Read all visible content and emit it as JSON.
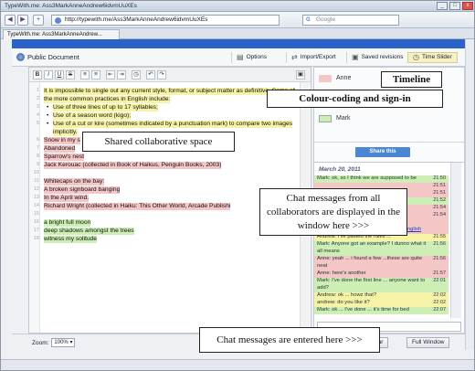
{
  "window": {
    "title": "TypeWith.me: Ass3MarkAnneAndrew6idvmUuXEs",
    "minimize": "_",
    "maximize": "□",
    "close": "x"
  },
  "browser": {
    "back": "◀",
    "forward": "▶",
    "new_tab": "+",
    "address": "http://typewith.me/Ass3MarkAnneAndrew6idvmUuXEs",
    "search_placeholder": "Google",
    "search_glyph": "G",
    "tab_title": "TypeWith.me: Ass3MarkAnneAndrew..."
  },
  "toolbar": {
    "doc_title": "Public Document",
    "options": "Options",
    "import_export": "Import/Export",
    "saved_revisions": "Saved revisions",
    "time_slider": "Time Slider"
  },
  "format_buttons": [
    "B",
    "I",
    "U",
    "S",
    "≡",
    "≡",
    "⇤",
    "⇥",
    "◷",
    "↶",
    "↷"
  ],
  "save_glyph": "▣",
  "editor_lines": [
    {
      "n": "1",
      "text": "It is impossible to single out any current style, format, or subject matter as definitive. Some of",
      "hl": "y",
      "bullet": false
    },
    {
      "n": "2",
      "text": "the more common practices in English include:",
      "hl": "y",
      "bullet": false
    },
    {
      "n": "3",
      "text": "Use of three lines of up to 17 syllables;",
      "hl": "y",
      "bullet": true
    },
    {
      "n": "4",
      "text": "Use of a season word (kigo);",
      "hl": "y",
      "bullet": true
    },
    {
      "n": "5",
      "text": "Use of a cut or kire (sometimes indicated by a punctuation mark) to compare two images",
      "hl": "y",
      "bullet": true
    },
    {
      "n": "",
      "text": "implicitly.",
      "hl": "y",
      "bullet": true,
      "cont": true
    },
    {
      "n": "6",
      "text": "Snow in my s",
      "hl": "p",
      "bullet": false
    },
    {
      "n": "7",
      "text": "Abandoned",
      "hl": "p",
      "bullet": false
    },
    {
      "n": "8",
      "text": "Sparrow's nest",
      "hl": "p",
      "bullet": false
    },
    {
      "n": "9",
      "text": "Jack Kerouac (collected in Book of Haikus, Penguin Books, 2003)",
      "hl": "p",
      "bullet": false
    },
    {
      "n": "10",
      "text": "",
      "hl": "",
      "bullet": false
    },
    {
      "n": "11",
      "text": "Whitecaps on the bay:",
      "hl": "p",
      "bullet": false
    },
    {
      "n": "12",
      "text": "A broken signboard banging",
      "hl": "p",
      "bullet": false
    },
    {
      "n": "13",
      "text": "In the April wind.",
      "hl": "p",
      "bullet": false
    },
    {
      "n": "14",
      "text": "Richard Wright (collected in Haiku: This Other World, Arcade Publishi",
      "hl": "p",
      "bullet": false
    },
    {
      "n": "15",
      "text": "",
      "hl": "",
      "bullet": false
    },
    {
      "n": "16",
      "text": "a bright full moon",
      "hl": "g",
      "bullet": false
    },
    {
      "n": "17",
      "text": "deep shadows amongst the trees",
      "hl": "g",
      "bullet": false
    },
    {
      "n": "18",
      "text": "witness my solitude",
      "hl": "g",
      "bullet": false
    }
  ],
  "authors": [
    {
      "name": "Anne",
      "color": "#f4c6c6"
    },
    {
      "name": "Mark",
      "color": "#cdeeb4"
    }
  ],
  "share_button": "Share this",
  "chat": {
    "date": "March 20, 2011",
    "messages": [
      {
        "text": "Mark: ok, so I think we are supposed to be",
        "time": "21:50",
        "color": "#cdeeb4"
      },
      {
        "text": "",
        "time": "21:51",
        "color": "#f4c6c6"
      },
      {
        "text": "",
        "time": "21:51",
        "color": "#f4c6c6"
      },
      {
        "text": "",
        "time": "21:52",
        "color": "#cdeeb4"
      },
      {
        "text": "",
        "time": "21:54",
        "color": "#f4c6c6"
      },
      {
        "text": "",
        "time": "21:54",
        "color": "#f4c6c6"
      },
      {
        "text": "Mark:",
        "time": "",
        "color": "#f4c6c6"
      },
      {
        "text": "http://en.wikipedia.org/wiki/Haiku_in_English",
        "time": "",
        "color": "#f4c6c6",
        "link": true
      },
      {
        "text": "Andrew: I've pasted the rules ...",
        "time": "21:55",
        "color": "#f6f3a6"
      },
      {
        "text": "Mark: Anyone got an example? I dunno what it",
        "time": "21:56",
        "color": "#cdeeb4"
      },
      {
        "text": "all means",
        "time": "",
        "color": "#cdeeb4"
      },
      {
        "text": "Anne: yeah ... i found a few ...these are quite",
        "time": "21:56",
        "color": "#f4c6c6"
      },
      {
        "text": "neat",
        "time": "",
        "color": "#f4c6c6"
      },
      {
        "text": "Anne: here's another",
        "time": "21:57",
        "color": "#f4c6c6"
      },
      {
        "text": "Mark: I've done the first line ... anyone want to",
        "time": "22:01",
        "color": "#cdeeb4"
      },
      {
        "text": "add?",
        "time": "",
        "color": "#cdeeb4"
      },
      {
        "text": "Andrew: ok ... howz that?",
        "time": "22:02",
        "color": "#f6f3a6"
      },
      {
        "text": "andrew: do you like it?",
        "time": "22:02",
        "color": "#f6f3a6"
      },
      {
        "text": "Mark: ok ... I've done ... it's time for bed",
        "time": "22:07",
        "color": "#cdeeb4"
      }
    ]
  },
  "bottom": {
    "zoom_label": "Zoom:",
    "zoom_value": "100%",
    "zoom_arrow": "▾",
    "sidebar": "Sidebar",
    "full_window": "Full Window"
  },
  "callouts": {
    "timeline": "Timeline",
    "colour_coding": "Colour-coding and sign-in",
    "shared_space": "Shared collaborative space",
    "chat_line1": "Chat messages from all",
    "chat_line2": "collaborators are displayed in the",
    "chat_line3": "window here >>>",
    "entered": "Chat messages are entered here >>>"
  }
}
